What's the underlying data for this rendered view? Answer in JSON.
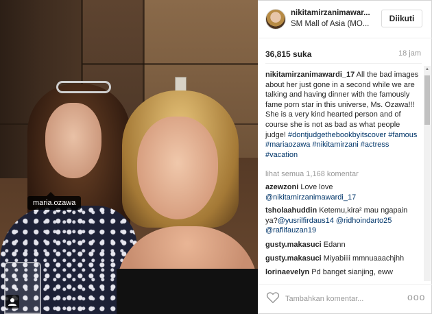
{
  "photo": {
    "people_tag": "maria.ozawa"
  },
  "header": {
    "username": "nikitamirzanimawar...",
    "location": "SM Mall of Asia (MO...",
    "follow_label": "Diikuti"
  },
  "stats": {
    "likes": "36,815 suka",
    "time_ago": "18 jam"
  },
  "caption": {
    "user": "nikitamirzanimawardi_17",
    "text": " All the bad images about her just gone in a second while we are talking and having dinner with the famously fame porn star in this universe, Ms. Ozawa!!! She is a very kind hearted person and of course she is not as bad as what people judge!",
    "hashtags": "#dontjudgethebookbyitscover #famous #mariaozawa #nikitamirzani #actress #vacation"
  },
  "view_all": "lihat semua 1,168 komentar",
  "comments": [
    {
      "user": "azewzoni",
      "text": " Love love ",
      "tag": "@nikitamirzanimawardi_17"
    },
    {
      "user": "tsholaahuddin",
      "text": " Ketemu,kira² mau ngapain ya?",
      "tag": "@yusrilfirdaus14 @ridhoindarto25 @raflifauzan19"
    },
    {
      "user": "gusty.makasuci",
      "text": " Edann",
      "tag": ""
    },
    {
      "user": "gusty.makasuci",
      "text": " Miyabiiii mmnuaaachjhh",
      "tag": ""
    },
    {
      "user": "lorinaevelyn",
      "text": " Pd banget sianjing, eww",
      "tag": ""
    }
  ],
  "input": {
    "placeholder": "Tambahkan komentar..."
  },
  "more_label": "ooo",
  "colors": {
    "link": "#003569",
    "muted": "#999999",
    "text": "#262626"
  },
  "icons": {
    "heart": "heart-outline-icon",
    "user_tag": "user-tag-icon",
    "more": "more-options-icon"
  }
}
